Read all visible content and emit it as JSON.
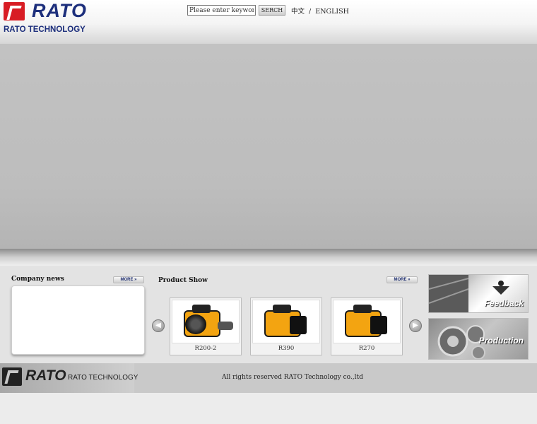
{
  "header": {
    "logo_word": "RATO",
    "logo_sub": "RATO TECHNOLOGY",
    "search": {
      "placeholder": "Please enter keyword!",
      "button_label": "SERCH"
    },
    "lang_chinese": "中文",
    "lang_separator": "/",
    "lang_english": "ENGLISH"
  },
  "news": {
    "title": "Company news",
    "more_label": "MORE »"
  },
  "products": {
    "title": "Product Show",
    "more_label": "MORE »",
    "items": [
      {
        "name": "R200-2"
      },
      {
        "name": "R390"
      },
      {
        "name": "R270"
      }
    ],
    "prev_icon": "left-arrow-icon",
    "next_icon": "right-arrow-icon"
  },
  "side_links": [
    {
      "label": "Feedback"
    },
    {
      "label": "Production"
    }
  ],
  "footer": {
    "logo_word": "RATO",
    "logo_sub": "RATO TECHNOLOGY",
    "copyright": "All rights reserved RATO Technology co.,ltd"
  },
  "colors": {
    "brand_blue": "#1d2f7c",
    "brand_red": "#d81c24",
    "engine_orange": "#f3a411"
  }
}
